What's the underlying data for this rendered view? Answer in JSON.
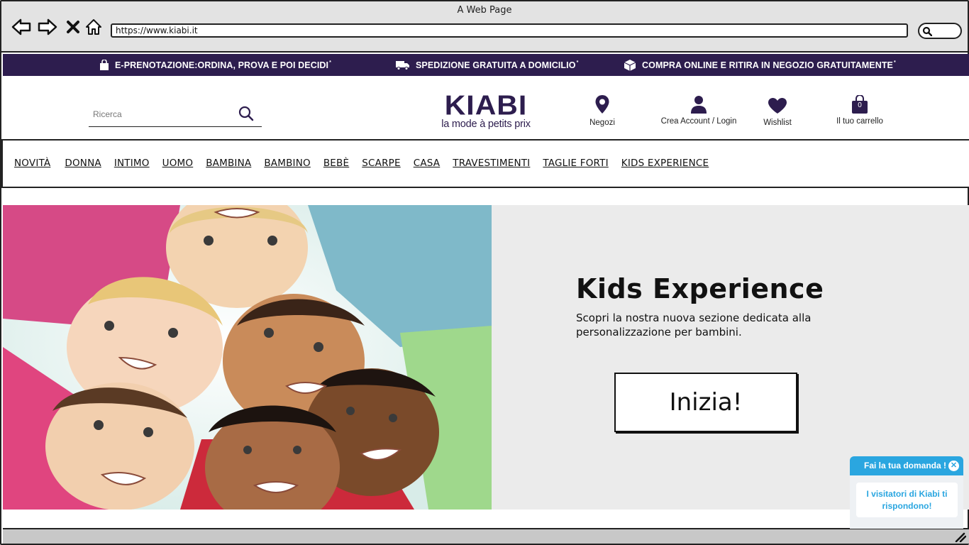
{
  "browser": {
    "window_title": "A Web Page",
    "url": "https://www.kiabi.it"
  },
  "promo": {
    "items": [
      {
        "label": "E-PRENOTAZIONE:ORDINA, PROVA E POI DECIDI",
        "mark": "*",
        "icon": "shopping-bag-icon"
      },
      {
        "label": "SPEDIZIONE GRATUITA A DOMICILIO",
        "mark": "*",
        "icon": "delivery-truck-icon"
      },
      {
        "label": "COMPRA ONLINE E RITIRA IN NEGOZIO GRATUITAMENTE",
        "mark": "*",
        "icon": "package-box-icon"
      }
    ],
    "background": "#2d1d4e"
  },
  "header": {
    "search_placeholder": "Ricerca",
    "logo_main": "KIABI",
    "logo_tagline": "la mode à petits prix",
    "stores_label": "Negozi",
    "account_label": "Crea Account / Login",
    "wishlist_label": "Wishlist",
    "cart_label": "Il tuo carrello",
    "cart_count": "0"
  },
  "nav": {
    "items": [
      "NOVITÀ",
      "DONNA",
      "INTIMO",
      "UOMO",
      "BAMBINA",
      "BAMBINO",
      "BEBÈ",
      "SCARPE",
      "CASA",
      "TRAVESTIMENTI",
      "TAGLIE FORTI",
      "KIDS EXPERIENCE"
    ]
  },
  "hero": {
    "title": "Kids Experience",
    "description": "Scopri la nostra nuova sezione dedicata alla personalizzazione per bambini.",
    "button_label": "Inizia!"
  },
  "chat": {
    "header": "Fai la tua domanda !",
    "body": "I visitatori di Kiabi ti rispondono!",
    "accent": "#2aa6e0"
  }
}
